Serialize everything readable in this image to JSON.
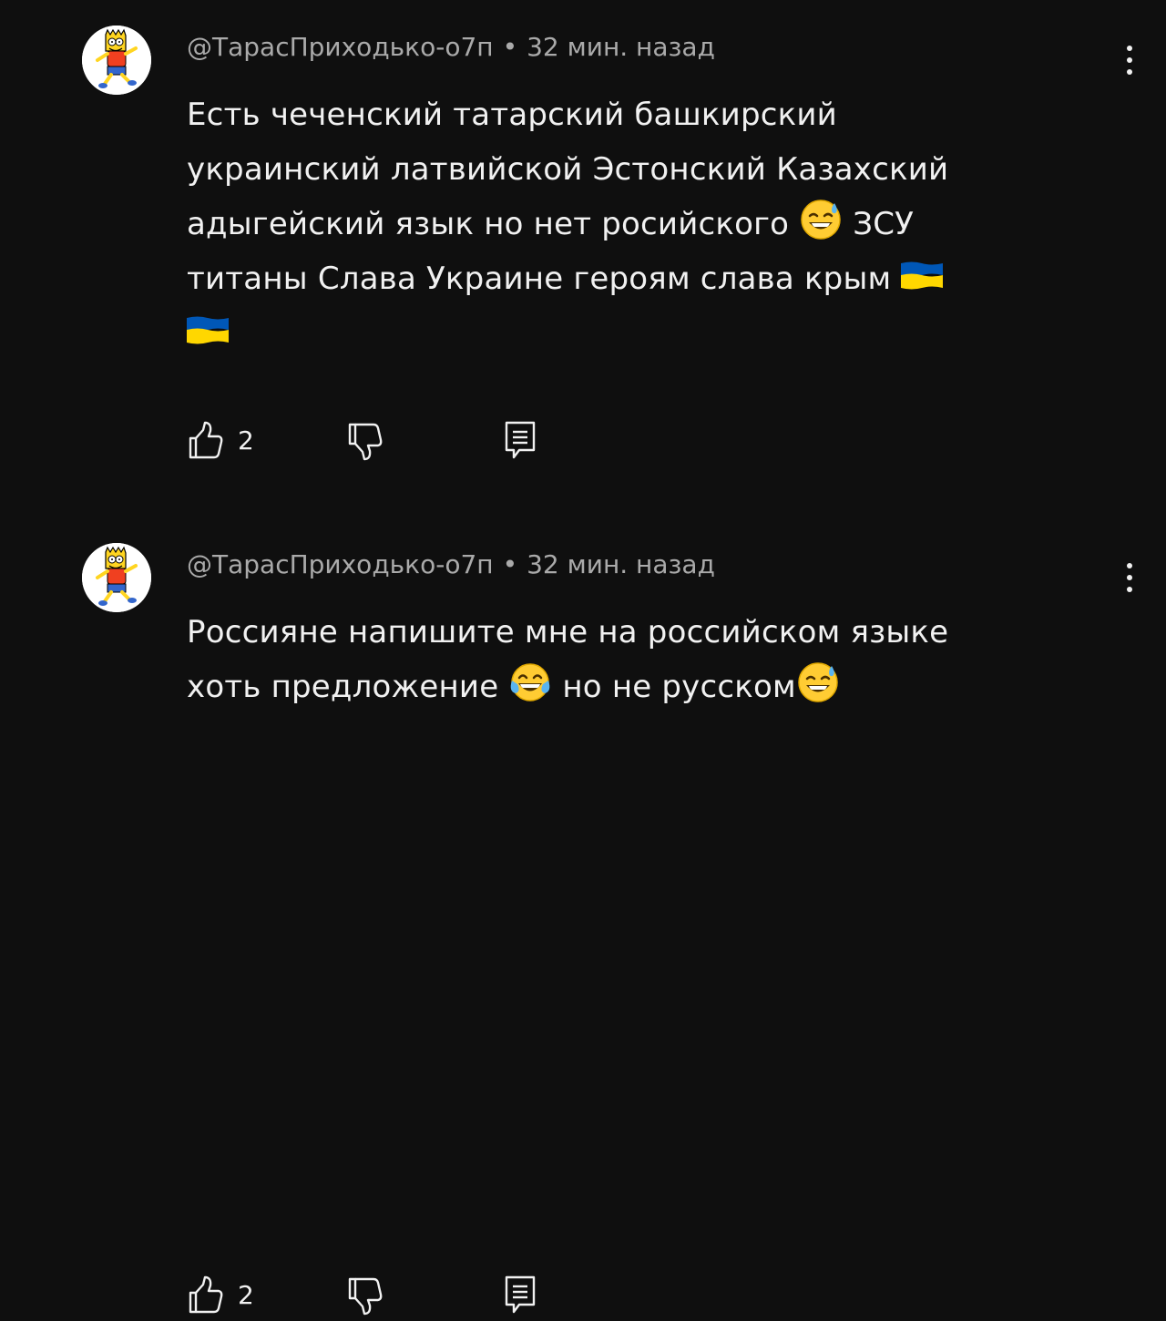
{
  "comments": [
    {
      "author": "@ТарасПриходько-о7п",
      "separator": "•",
      "time": "32 мин. назад",
      "text_lines": [
        "Есть чеченский татарский башкирский",
        "украинский латвийской Эстонский Казахский",
        "адыгейский язык но нет росийского",
        "ЗСУ",
        "титаны Слава Украине героям слава крым"
      ],
      "emoji": [
        "grinning-face-with-sweat",
        "flag-ukraine",
        "flag-ukraine"
      ],
      "likes": "2"
    },
    {
      "author": "@ТарасПриходько-о7п",
      "separator": "•",
      "time": "32 мин. назад",
      "text_lines": [
        "Россияне напишите мне на российском языке",
        "хоть предложение",
        "но не русском"
      ],
      "emoji": [
        "face-with-tears-of-joy",
        "grinning-face-with-sweat"
      ],
      "likes": "2"
    }
  ],
  "icons": {
    "avatar": "cartoon-avatar-icon",
    "menu": "more-vert-icon",
    "like": "thumb-up-icon",
    "dislike": "thumb-down-icon",
    "reply": "reply-icon"
  },
  "colors": {
    "background": "#0f0f0f",
    "text": "#f1f1f1",
    "meta": "#aaaaaa",
    "flag_blue": "#0057b7",
    "flag_yellow": "#ffd700"
  }
}
